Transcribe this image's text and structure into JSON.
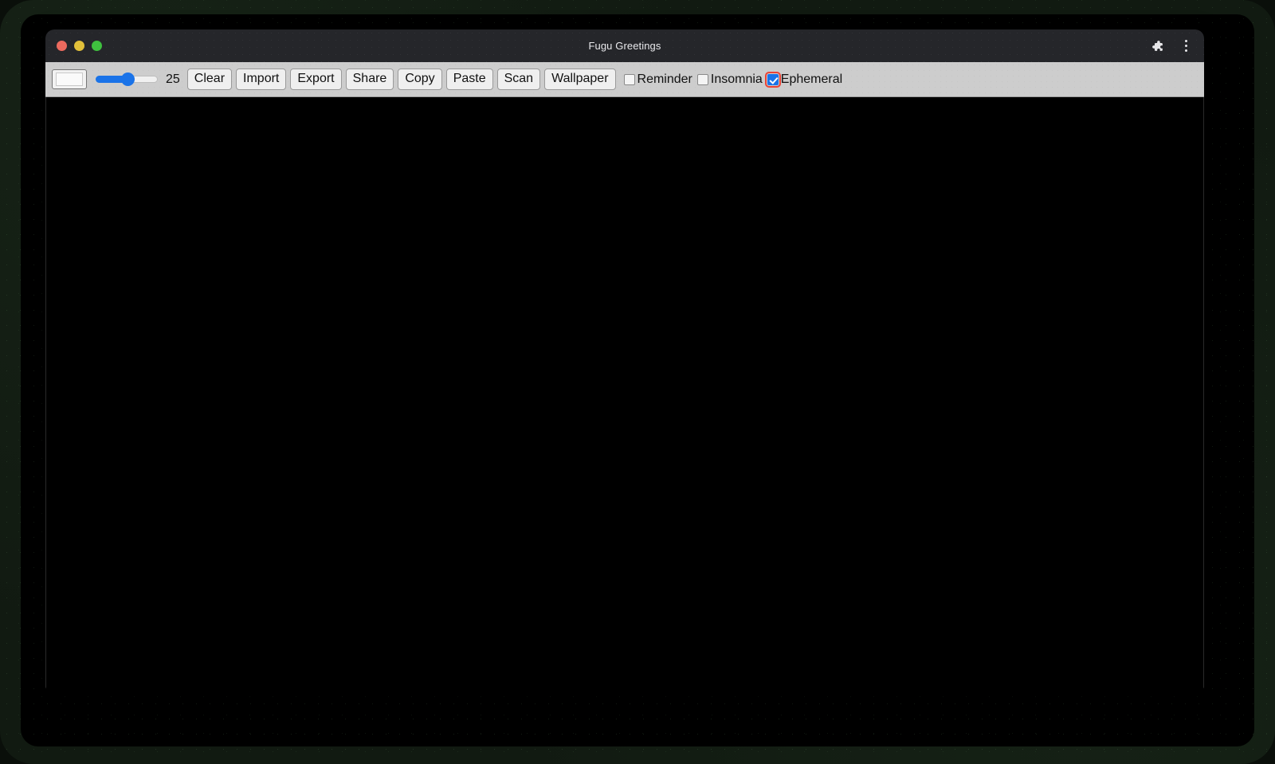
{
  "window": {
    "title": "Fugu Greetings",
    "traffic_lights": [
      {
        "name": "close",
        "color": "#ec6a5e"
      },
      {
        "name": "minimize",
        "color": "#e2c03a"
      },
      {
        "name": "maximize",
        "color": "#3fc13f"
      }
    ],
    "titlebar_icons": [
      {
        "name": "extensions-icon",
        "glyph": "🧩"
      },
      {
        "name": "more-menu-icon",
        "glyph": "⋮"
      }
    ]
  },
  "toolbar": {
    "color_picker": {
      "label": "color-picker",
      "value": "#fafafa"
    },
    "slider": {
      "value": "25",
      "min": "0",
      "max": "50",
      "percent": 52,
      "accent": "#1a73e8"
    },
    "buttons": [
      {
        "name": "clear-button",
        "label": "Clear"
      },
      {
        "name": "import-button",
        "label": "Import"
      },
      {
        "name": "export-button",
        "label": "Export"
      },
      {
        "name": "share-button",
        "label": "Share"
      },
      {
        "name": "copy-button",
        "label": "Copy"
      },
      {
        "name": "paste-button",
        "label": "Paste"
      },
      {
        "name": "scan-button",
        "label": "Scan"
      },
      {
        "name": "wallpaper-button",
        "label": "Wallpaper"
      }
    ],
    "checkboxes": [
      {
        "name": "reminder-checkbox",
        "label": "Reminder",
        "checked": false,
        "focused": false
      },
      {
        "name": "insomnia-checkbox",
        "label": "Insomnia",
        "checked": false,
        "focused": false
      },
      {
        "name": "ephemeral-checkbox",
        "label": "Ephemeral",
        "checked": true,
        "focused": true
      }
    ]
  },
  "canvas": {
    "name": "drawing-canvas",
    "background": "#000000",
    "content": ""
  },
  "colors": {
    "toolbar_bg": "#cdcdcd",
    "titlebar_bg": "#25262a",
    "accent": "#1a73e8",
    "focus_ring": "#ea4335",
    "desktop_bg": "#111a11"
  }
}
